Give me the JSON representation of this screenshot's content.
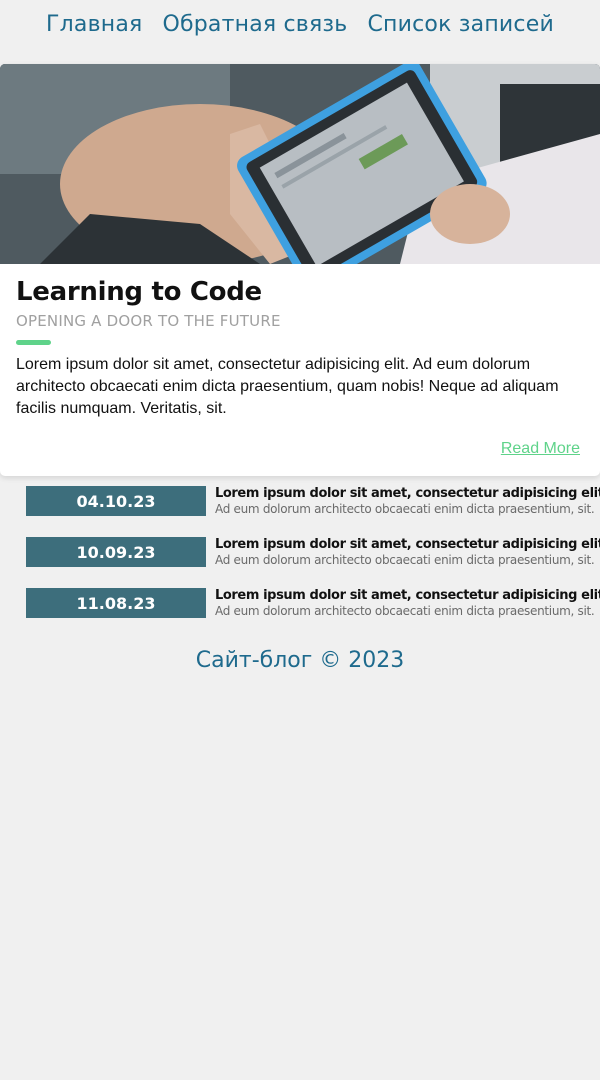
{
  "nav": {
    "items": [
      "Главная",
      "Обратная связь",
      "Список записей"
    ]
  },
  "card": {
    "image_alt": "person holding tablet",
    "title": "Learning to Code",
    "subtitle": "OPENING A DOOR TO THE FUTURE",
    "text": "Lorem ipsum dolor sit amet, consectetur adipisicing elit. Ad eum dolorum architecto obcaecati enim dicta praesentium, quam nobis! Neque ad aliquam facilis numquam. Veritatis, sit.",
    "read_more": "Read More"
  },
  "entries": [
    {
      "date": "04.10.23",
      "title": "Lorem ipsum dolor sit amet, consectetur adipisicing elit.",
      "desc": "Ad eum dolorum architecto obcaecati enim dicta praesentium, sit."
    },
    {
      "date": "10.09.23",
      "title": "Lorem ipsum dolor sit amet, consectetur adipisicing elit.",
      "desc": "Ad eum dolorum architecto obcaecati enim dicta praesentium, sit."
    },
    {
      "date": "11.08.23",
      "title": "Lorem ipsum dolor sit amet, consectetur adipisicing elit.",
      "desc": "Ad eum dolorum architecto obcaecati enim dicta praesentium, sit."
    }
  ],
  "footer": {
    "text": "Сайт-блог © 2023"
  },
  "colors": {
    "nav_link": "#1e6a8d",
    "accent": "#5fd38a",
    "date_bg": "#3d6e7c",
    "background": "#f0f0f0"
  }
}
